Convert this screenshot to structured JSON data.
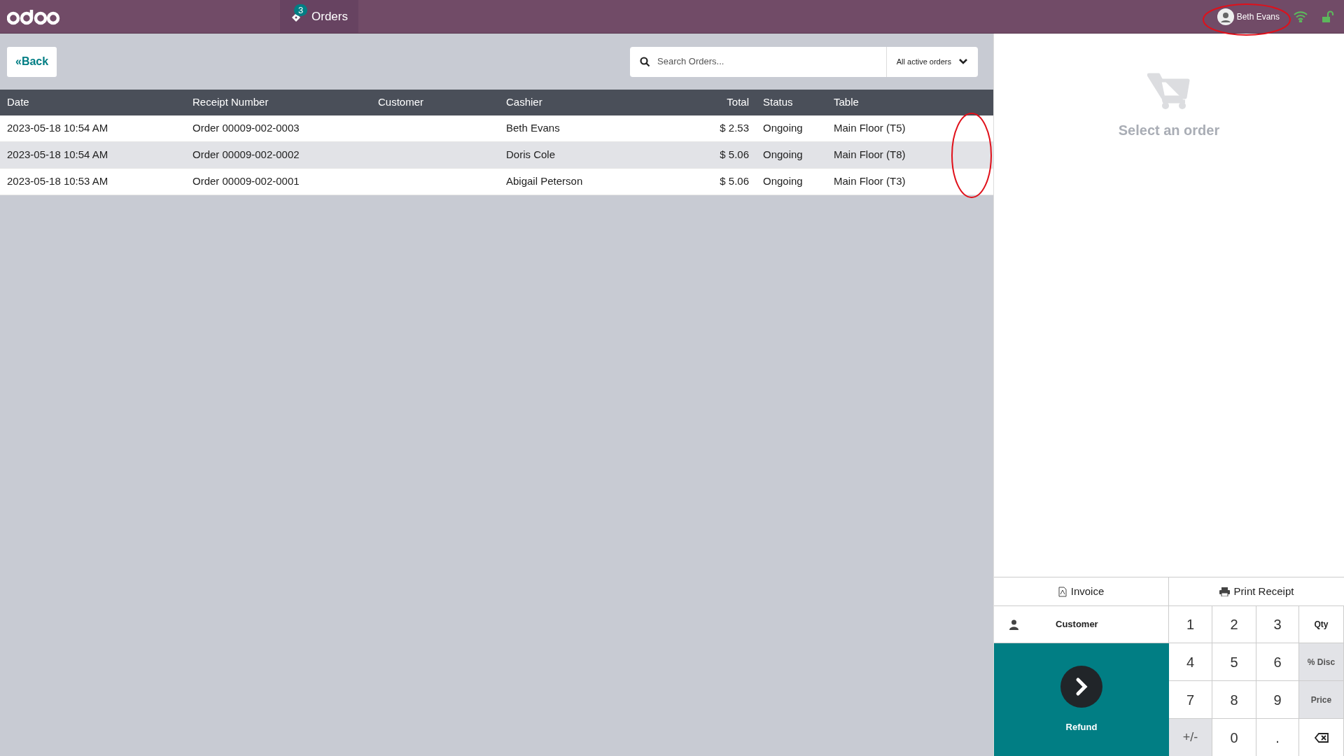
{
  "navbar": {
    "orders_tab": {
      "label": "Orders",
      "badge": "3"
    },
    "user": "Beth Evans"
  },
  "back_button": {
    "icon": "«",
    "label": "Back"
  },
  "search": {
    "placeholder": "Search Orders...",
    "filter": "All active orders"
  },
  "table": {
    "columns": [
      {
        "label": "Date"
      },
      {
        "label": "Receipt Number"
      },
      {
        "label": "Customer"
      },
      {
        "label": "Cashier"
      },
      {
        "label": "Total"
      },
      {
        "label": "Status"
      },
      {
        "label": "Table"
      }
    ],
    "rows": [
      {
        "selected": false,
        "cells": [
          "2023-05-18 10:54 AM",
          "Order 00009-002-0003",
          "",
          "Beth Evans",
          "$ 2.53",
          "Ongoing",
          "Main Floor (T5)"
        ]
      },
      {
        "selected": true,
        "cells": [
          "2023-05-18 10:54 AM",
          "Order 00009-002-0002",
          "",
          "Doris Cole",
          "$ 5.06",
          "Ongoing",
          "Main Floor (T8)"
        ]
      },
      {
        "selected": false,
        "cells": [
          "2023-05-18 10:53 AM",
          "Order 00009-002-0001",
          "",
          "Abigail Peterson",
          "$ 5.06",
          "Ongoing",
          "Main Floor (T3)"
        ]
      }
    ]
  },
  "empty_state": "Select an order",
  "actions": {
    "invoice": "Invoice",
    "print_receipt": "Print Receipt",
    "customer": "Customer",
    "refund": "Refund"
  },
  "numpad": [
    {
      "kind": "digit",
      "label": "1"
    },
    {
      "kind": "digit",
      "label": "2"
    },
    {
      "kind": "digit",
      "label": "3"
    },
    {
      "kind": "mode",
      "label": "Qty",
      "selected": true
    },
    {
      "kind": "digit",
      "label": "4"
    },
    {
      "kind": "digit",
      "label": "5"
    },
    {
      "kind": "digit",
      "label": "6"
    },
    {
      "kind": "mode",
      "label": "% Disc",
      "selected": false
    },
    {
      "kind": "digit",
      "label": "7"
    },
    {
      "kind": "digit",
      "label": "8"
    },
    {
      "kind": "digit",
      "label": "9"
    },
    {
      "kind": "mode",
      "label": "Price",
      "selected": false
    },
    {
      "kind": "sign",
      "label": "+/-"
    },
    {
      "kind": "digit",
      "label": "0"
    },
    {
      "kind": "digit",
      "label": "."
    },
    {
      "kind": "backspace"
    }
  ]
}
